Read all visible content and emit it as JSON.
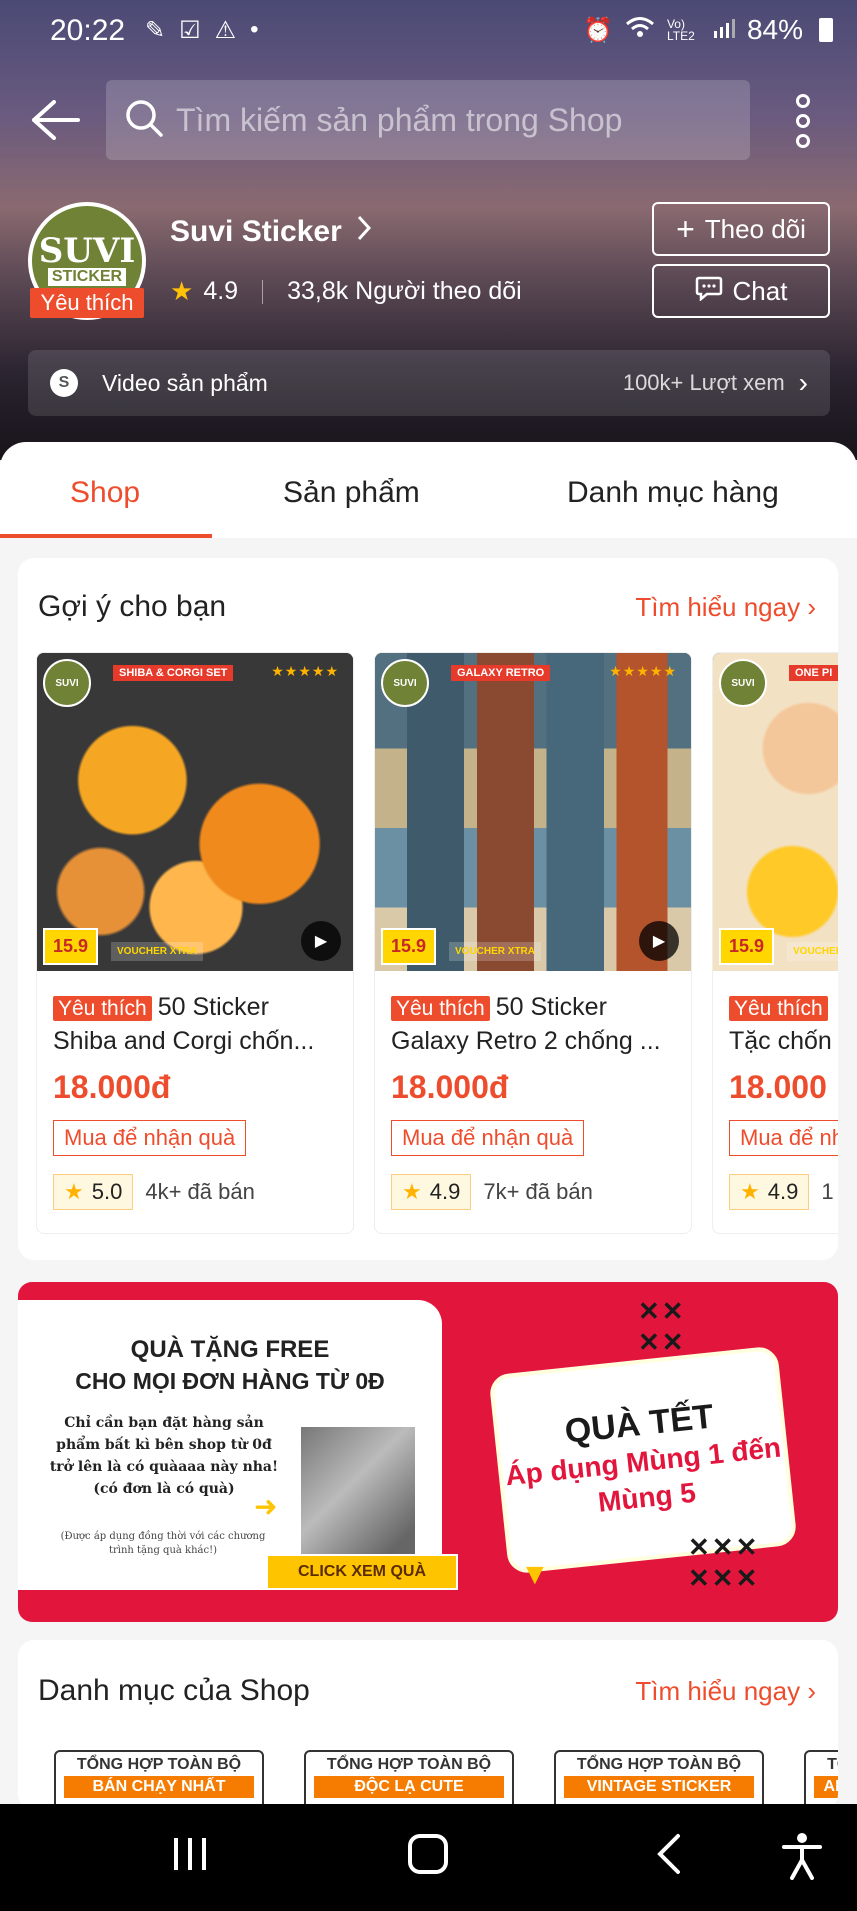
{
  "status_bar": {
    "time": "20:22",
    "battery": "84%",
    "network": "Vo) LTE2"
  },
  "search": {
    "placeholder": "Tìm kiếm sản phẩm trong Shop"
  },
  "shop": {
    "logo_line1": "SUVI",
    "logo_line2": "STICKER",
    "badge": "Yêu thích",
    "name": "Suvi Sticker",
    "rating": "4.9",
    "followers": "33,8k Người theo dõi",
    "follow_label": "Theo dõi",
    "chat_label": "Chat"
  },
  "video": {
    "label": "Video sản phẩm",
    "views": "100k+ Lượt xem"
  },
  "tabs": [
    {
      "label": "Shop"
    },
    {
      "label": "Sản phẩm"
    },
    {
      "label": "Danh mục hàng"
    }
  ],
  "suggest": {
    "title": "Gợi ý cho bạn",
    "link": "Tìm hiểu ngay",
    "products": [
      {
        "badge": "Yêu thích",
        "name": "50 Sticker Shiba and Corgi chốn...",
        "price": "18.000đ",
        "promo": "Mua để nhận quà",
        "rating": "5.0",
        "sold": "4k+ đã bán",
        "img_tag": "SHIBA & CORGI SET",
        "price_tag": "15.9",
        "voucher": "VOUCHER XTRA"
      },
      {
        "badge": "Yêu thích",
        "name": "50 Sticker Galaxy Retro 2 chống ...",
        "price": "18.000đ",
        "promo": "Mua để nhận quà",
        "rating": "4.9",
        "sold": "7k+ đã bán",
        "img_tag": "GALAXY RETRO",
        "price_tag": "15.9",
        "voucher": "VOUCHER XTRA"
      },
      {
        "badge": "Yêu thích",
        "name": "Tặc chốn",
        "price": "18.000",
        "promo": "Mua để nh",
        "rating": "4.9",
        "sold": "1",
        "img_tag": "ONE PI",
        "price_tag": "15.9",
        "voucher": "VOUCHER XTRA"
      }
    ]
  },
  "banner": {
    "title1": "QUÀ TẶNG FREE",
    "title2": "CHO MỌI ĐƠN HÀNG TỪ 0Đ",
    "desc": "Chỉ cần bạn đặt hàng sản phẩm bất kì bên shop từ 0đ trở lên là có quàaaa này nha! (có đơn là có quà)",
    "note": "(Được áp dụng đồng thời với các chương trình tặng quà khác!)",
    "cta": "CLICK XEM QUÀ",
    "right_title": "QUÀ TẾT",
    "right_sub": "Áp dụng Mùng 1 đến Mùng 5"
  },
  "categories": {
    "title": "Danh mục của Shop",
    "link": "Tìm hiểu ngay",
    "items": [
      {
        "line1": "TỔNG HỢP TOÀN BỘ",
        "line2": "BÁN CHẠY NHẤT"
      },
      {
        "line1": "TỔNG HỢP TOÀN BỘ",
        "line2": "ĐỘC LẠ CUTE"
      },
      {
        "line1": "TỔNG HỢP TOÀN BỘ",
        "line2": "VINTAGE STICKER"
      },
      {
        "line1": "TỔN",
        "line2": "ANIM"
      }
    ]
  },
  "colors": {
    "accent": "#ee4d2d",
    "banner": "#e2163d",
    "star": "#ffb300"
  }
}
